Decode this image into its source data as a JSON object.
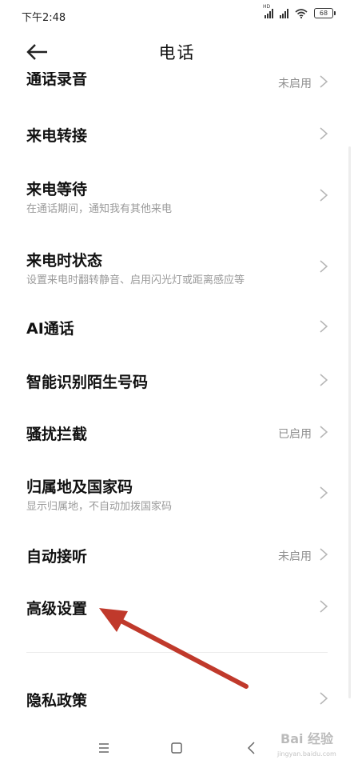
{
  "status_bar": {
    "time": "下午2:48",
    "hd_label": "HD",
    "battery": "68",
    "icons": [
      "signal-icon",
      "signal-icon",
      "wifi-icon",
      "battery-icon"
    ]
  },
  "header": {
    "title": "电话",
    "back_icon": "arrow-left-icon"
  },
  "settings": [
    {
      "title": "通话录音",
      "value": "未启用"
    },
    {
      "title": "来电转接"
    },
    {
      "title": "来电等待",
      "subtitle": "在通话期间，通知我有其他来电"
    },
    {
      "title": "来电时状态",
      "subtitle": "设置来电时翻转静音、启用闪光灯或距离感应等"
    },
    {
      "title": "AI通话"
    },
    {
      "title": "智能识别陌生号码"
    },
    {
      "title": "骚扰拦截",
      "value": "已启用"
    },
    {
      "title": "归属地及国家码",
      "subtitle": "显示归属地，不自动加拨国家码"
    },
    {
      "title": "自动接听",
      "value": "未启用"
    },
    {
      "title": "高级设置"
    },
    {
      "title": "隐私政策"
    }
  ],
  "nav_bar": {
    "icons": [
      "menu-icon",
      "home-icon",
      "back-icon"
    ]
  },
  "watermark": {
    "logo_text": "Bai 经验",
    "url": "jingyan.baidu.com"
  },
  "annotation": {
    "color": "#c0392b",
    "icon": "red-arrow-annotation"
  }
}
